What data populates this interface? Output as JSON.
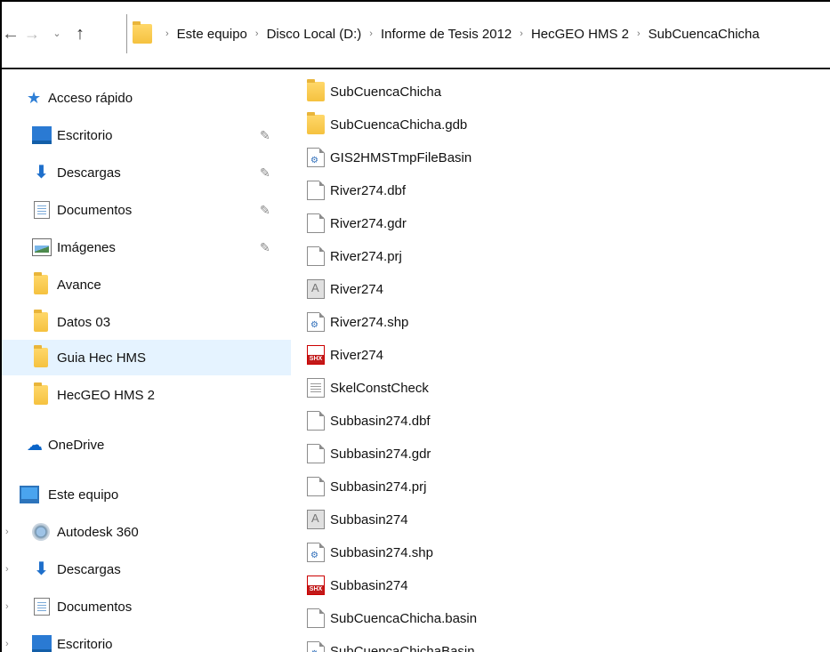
{
  "address_bar": {
    "back_icon": "←",
    "forward_icon": "→",
    "recent_icon": "⌄",
    "up_icon": "↑",
    "separator": "›",
    "crumbs": [
      "Este equipo",
      "Disco Local (D:)",
      "Informe de Tesis 2012",
      "HecGEO HMS 2",
      "SubCuencaChicha"
    ]
  },
  "nav_pane": {
    "items": [
      {
        "label": "Acceso rápido",
        "icon": "star-icon",
        "pinned": false
      },
      {
        "label": "Escritorio",
        "icon": "desktop-icon",
        "pinned": true
      },
      {
        "label": "Descargas",
        "icon": "download-icon",
        "pinned": true
      },
      {
        "label": "Documentos",
        "icon": "documents-icon",
        "pinned": true
      },
      {
        "label": "Imágenes",
        "icon": "images-icon",
        "pinned": true
      },
      {
        "label": "Avance",
        "icon": "folder-icon"
      },
      {
        "label": "Datos 03",
        "icon": "folder-icon"
      },
      {
        "label": "Guia Hec HMS",
        "icon": "folder-icon",
        "selected": true
      },
      {
        "label": "HecGEO HMS 2",
        "icon": "folder-icon"
      },
      {
        "label": "OneDrive",
        "icon": "cloud-icon"
      },
      {
        "label": "Este equipo",
        "icon": "computer-icon"
      },
      {
        "label": "Autodesk 360",
        "icon": "autodesk-icon"
      },
      {
        "label": "Descargas",
        "icon": "download-icon"
      },
      {
        "label": "Documentos",
        "icon": "documents-icon"
      },
      {
        "label": "Escritorio",
        "icon": "desktop-icon"
      }
    ],
    "pin_icon": "📌"
  },
  "files": [
    {
      "name": "SubCuencaChicha",
      "icon": "folder-icon"
    },
    {
      "name": "SubCuencaChicha.gdb",
      "icon": "folder-icon"
    },
    {
      "name": "GIS2HMSTmpFileBasin",
      "icon": "config-file-icon"
    },
    {
      "name": "River274.dbf",
      "icon": "blank-file-icon"
    },
    {
      "name": "River274.gdr",
      "icon": "blank-file-icon"
    },
    {
      "name": "River274.prj",
      "icon": "blank-file-icon"
    },
    {
      "name": "River274",
      "icon": "shapefile-icon"
    },
    {
      "name": "River274.shp",
      "icon": "config-file-icon"
    },
    {
      "name": "River274",
      "icon": "shx-file-icon"
    },
    {
      "name": "SkelConstCheck",
      "icon": "text-file-icon"
    },
    {
      "name": "Subbasin274.dbf",
      "icon": "blank-file-icon"
    },
    {
      "name": "Subbasin274.gdr",
      "icon": "blank-file-icon"
    },
    {
      "name": "Subbasin274.prj",
      "icon": "blank-file-icon"
    },
    {
      "name": "Subbasin274",
      "icon": "shapefile-icon"
    },
    {
      "name": "Subbasin274.shp",
      "icon": "config-file-icon"
    },
    {
      "name": "Subbasin274",
      "icon": "shx-file-icon"
    },
    {
      "name": "SubCuencaChicha.basin",
      "icon": "blank-file-icon"
    },
    {
      "name": "SubCuencaChichaBasin",
      "icon": "config-file-icon"
    }
  ]
}
